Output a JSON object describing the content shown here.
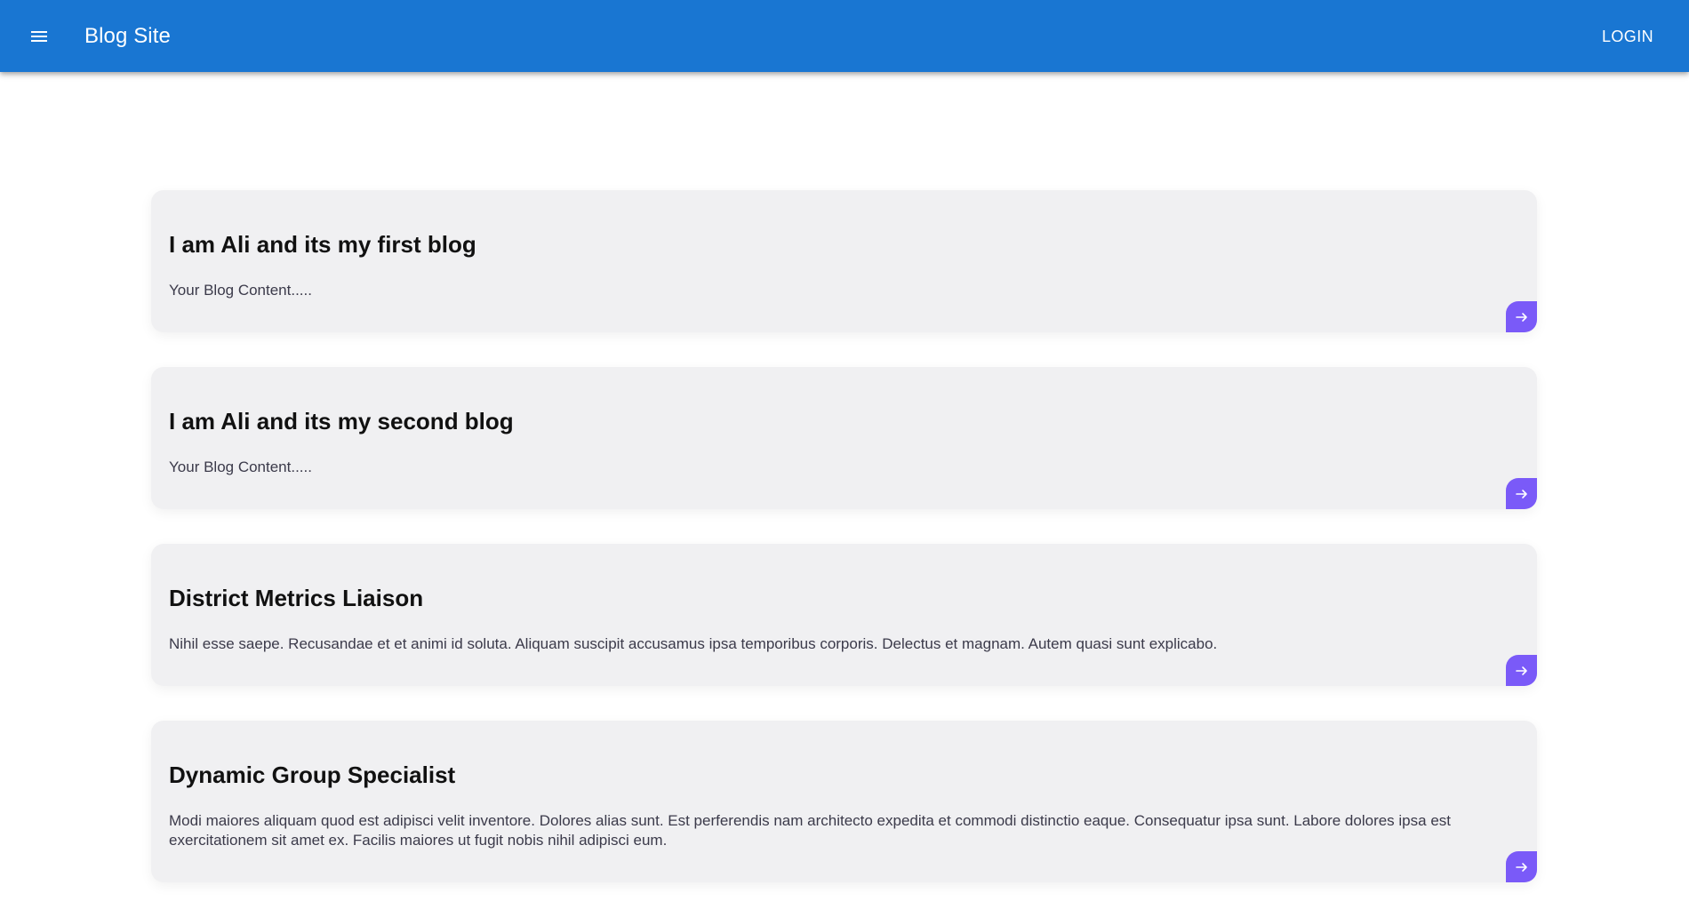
{
  "header": {
    "title": "Blog Site",
    "login_label": "LOGIN",
    "accent_color": "#1976d2"
  },
  "posts": [
    {
      "title": "I am Ali and its my first blog",
      "content": "Your Blog Content....."
    },
    {
      "title": "I am Ali and its my second blog",
      "content": "Your Blog Content....."
    },
    {
      "title": "District Metrics Liaison",
      "content": "Nihil esse saepe. Recusandae et et animi id soluta. Aliquam suscipit accusamus ipsa temporibus corporis. Delectus et magnam. Autem quasi sunt explicabo."
    },
    {
      "title": "Dynamic Group Specialist",
      "content": "Modi maiores aliquam quod est adipisci velit inventore. Dolores alias sunt. Est perferendis nam architecto expedita et commodi distinctio eaque. Consequatur ipsa sunt. Labore dolores ipsa est exercitationem sit amet ex. Facilis maiores ut fugit nobis nihil adipisci eum."
    }
  ],
  "card_button": {
    "icon": "arrow-right-icon",
    "color": "#7a5af8"
  }
}
